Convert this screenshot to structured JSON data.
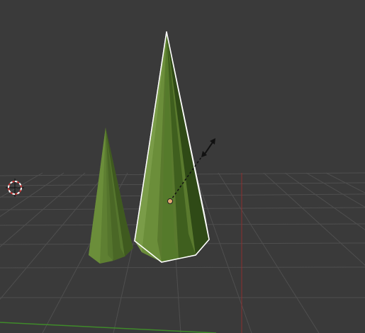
{
  "viewport": {
    "mode": "3d-viewport",
    "background_color": "#3a3a3a",
    "grid_color": "#4f4f4f",
    "x_axis_color": "#8c2f2f",
    "y_axis_color": "#3f8a2a"
  },
  "objects": [
    {
      "name": "cone-small",
      "selected": false,
      "color": "#6b8e3a"
    },
    {
      "name": "cone-large",
      "selected": true,
      "color": "#6b8e3a",
      "outline_color": "#ffffff"
    }
  ],
  "cursor_icon": "3d-cursor-icon",
  "transform_gizmo_icon": "scale-arrow-icon",
  "origin_dot_color": "#e3a872"
}
